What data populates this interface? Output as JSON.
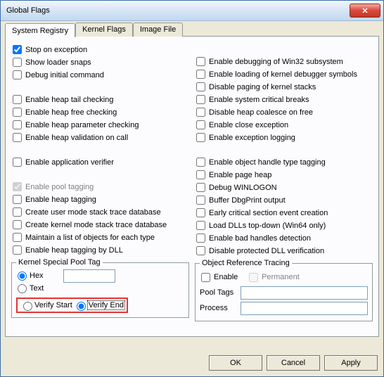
{
  "window": {
    "title": "Global Flags"
  },
  "tabs": {
    "t0": "System Registry",
    "t1": "Kernel Flags",
    "t2": "Image File"
  },
  "left": {
    "c0": "Stop on exception",
    "c1": "Show loader snaps",
    "c2": "Debug initial command",
    "c3": "Enable heap tail checking",
    "c4": "Enable heap free checking",
    "c5": "Enable heap parameter checking",
    "c6": "Enable heap validation on call",
    "c7": "Enable application verifier",
    "c8": "Enable pool tagging",
    "c9": "Enable heap tagging",
    "c10": "Create user mode stack trace database",
    "c11": "Create kernel mode stack trace database",
    "c12": "Maintain a list of objects for each type",
    "c13": "Enable heap tagging by DLL"
  },
  "right": {
    "c0": "Enable debugging of Win32 subsystem",
    "c1": "Enable loading of kernel debugger symbols",
    "c2": "Disable paging of kernel stacks",
    "c3": "Enable system critical breaks",
    "c4": "Disable heap coalesce on free",
    "c5": "Enable close exception",
    "c6": "Enable exception logging",
    "c7": "Enable object handle type tagging",
    "c8": "Enable page heap",
    "c9": "Debug WINLOGON",
    "c10": "Buffer DbgPrint output",
    "c11": "Early critical section event creation",
    "c12": "Load DLLs top-down (Win64 only)",
    "c13": "Enable bad handles detection",
    "c14": "Disable protected DLL verification"
  },
  "kspt": {
    "legend": "Kernel Special Pool Tag",
    "hex": "Hex",
    "text": "Text",
    "verify_start": "Verify Start",
    "verify_end": "Verify End"
  },
  "ort": {
    "legend": "Object Reference Tracing",
    "enable": "Enable",
    "permanent": "Permanent",
    "pool_tags": "Pool Tags",
    "process": "Process"
  },
  "buttons": {
    "ok": "OK",
    "cancel": "Cancel",
    "apply": "Apply"
  }
}
